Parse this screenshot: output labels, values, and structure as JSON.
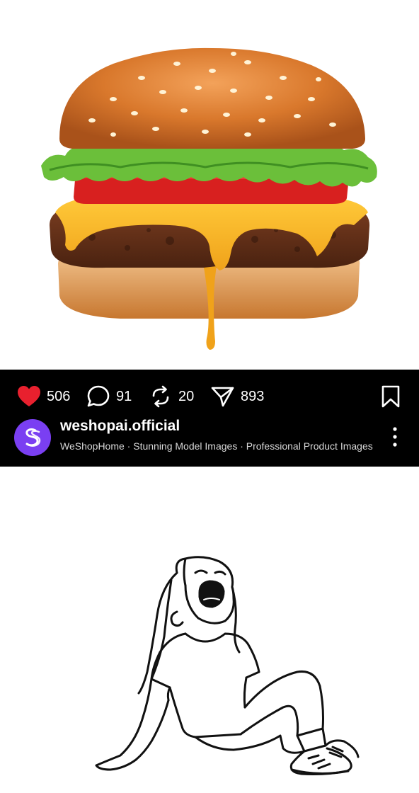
{
  "post": {
    "top_image": {
      "icon": "burger-photo"
    },
    "actions": {
      "likes": "506",
      "comments": "91",
      "reposts": "20",
      "shares": "893"
    },
    "author": {
      "username": "weshopai.official",
      "subtitle": "WeShopHome · Stunning Model Images · Professional Product Images",
      "avatar_color": "#7a3ff2"
    },
    "bottom_image": {
      "icon": "girl-crying-line-drawing"
    }
  },
  "colors": {
    "bar_background": "#000000",
    "like_red": "#e8202e",
    "text_white": "#ffffff"
  }
}
